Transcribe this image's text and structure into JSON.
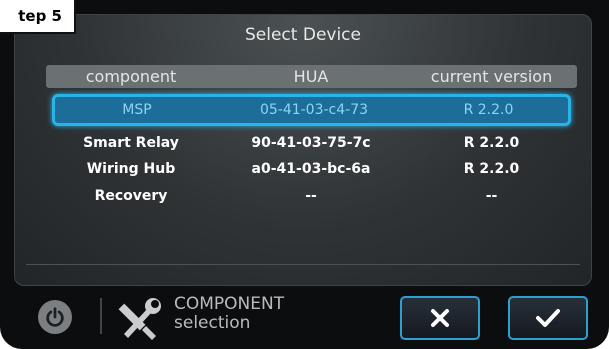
{
  "step_label": "tep 5",
  "screen": {
    "title": "Select Device",
    "columns": [
      "component",
      "HUA",
      "current version"
    ],
    "rows": [
      {
        "component": "MSP",
        "hua": "05-41-03-c4-73",
        "version": "R 2.2.0",
        "selected": true
      },
      {
        "component": "Smart Relay",
        "hua": "90-41-03-75-7c",
        "version": "R 2.2.0",
        "selected": false
      },
      {
        "component": "Wiring Hub",
        "hua": "a0-41-03-bc-6a",
        "version": "R 2.2.0",
        "selected": false
      },
      {
        "component": "Recovery",
        "hua": "--",
        "version": "--",
        "selected": false
      }
    ]
  },
  "bottom": {
    "mode_line1": "COMPONENT",
    "mode_line2": "selection",
    "icons": [
      "power-icon",
      "tools-icon",
      "close-icon",
      "check-icon"
    ]
  },
  "colors": {
    "accent": "#2ab3e6",
    "selected_row": "#1c6d99"
  }
}
